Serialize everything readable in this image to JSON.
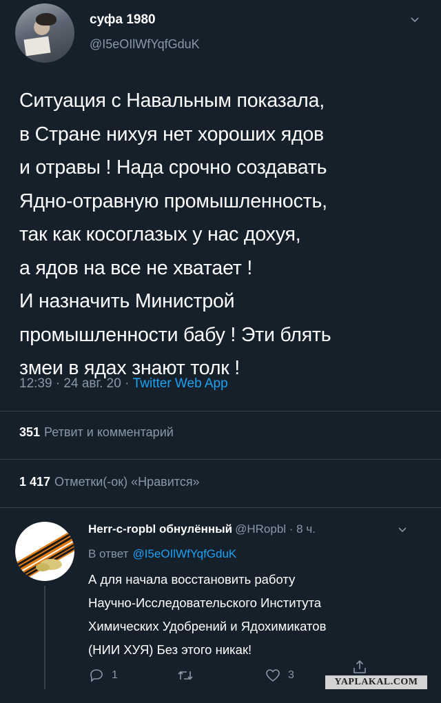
{
  "tweet": {
    "author_name": "суфа 1980",
    "author_handle": "@I5eOIlWfYqfGduK",
    "text": "Ситуация с Навальным показала,\nв Стране нихуя нет хороших ядов\nи отравы ! Нада срочно создавать\nЯдно-отравную промышленность,\nтак как косоглазых у нас дохуя,\nа ядов на все не хватает !\nИ назначить Министрой\nпромышленности бабу ! Эти блять\nзмеи в ядах знают толк !",
    "time": "12:39 · 24 авг. 20 · ",
    "source": "Twitter Web App",
    "retweets_count": "351",
    "retweets_label": "Ретвит и комментарий",
    "likes_count": "1 417",
    "likes_label": "Отметки(-ок) «Нравится»"
  },
  "reply": {
    "author_name": "Herr-c-ropbl обнулённый",
    "handle_and_time": "@HRopbl · 8 ч.",
    "in_reply_to_label": "В ответ",
    "in_reply_to_handle": "@I5eOIlWfYqfGduK",
    "text": "А для начала восстановить работу\nНаучно-Исследовательского Института\nХимических Удобрений и Ядохимикатов\n(НИИ ХУЯ) Без этого никак!",
    "actions": {
      "reply_count": "1",
      "retweet_count": "",
      "like_count": "3"
    }
  },
  "watermark": "YAPLAKAL.COM",
  "colors": {
    "background": "#15202b",
    "secondary_text": "#8899a6",
    "link": "#1da1f2",
    "divider": "#38444d"
  },
  "icons": [
    "chevron-down-icon",
    "reply-icon",
    "retweet-icon",
    "like-icon",
    "share-icon"
  ]
}
